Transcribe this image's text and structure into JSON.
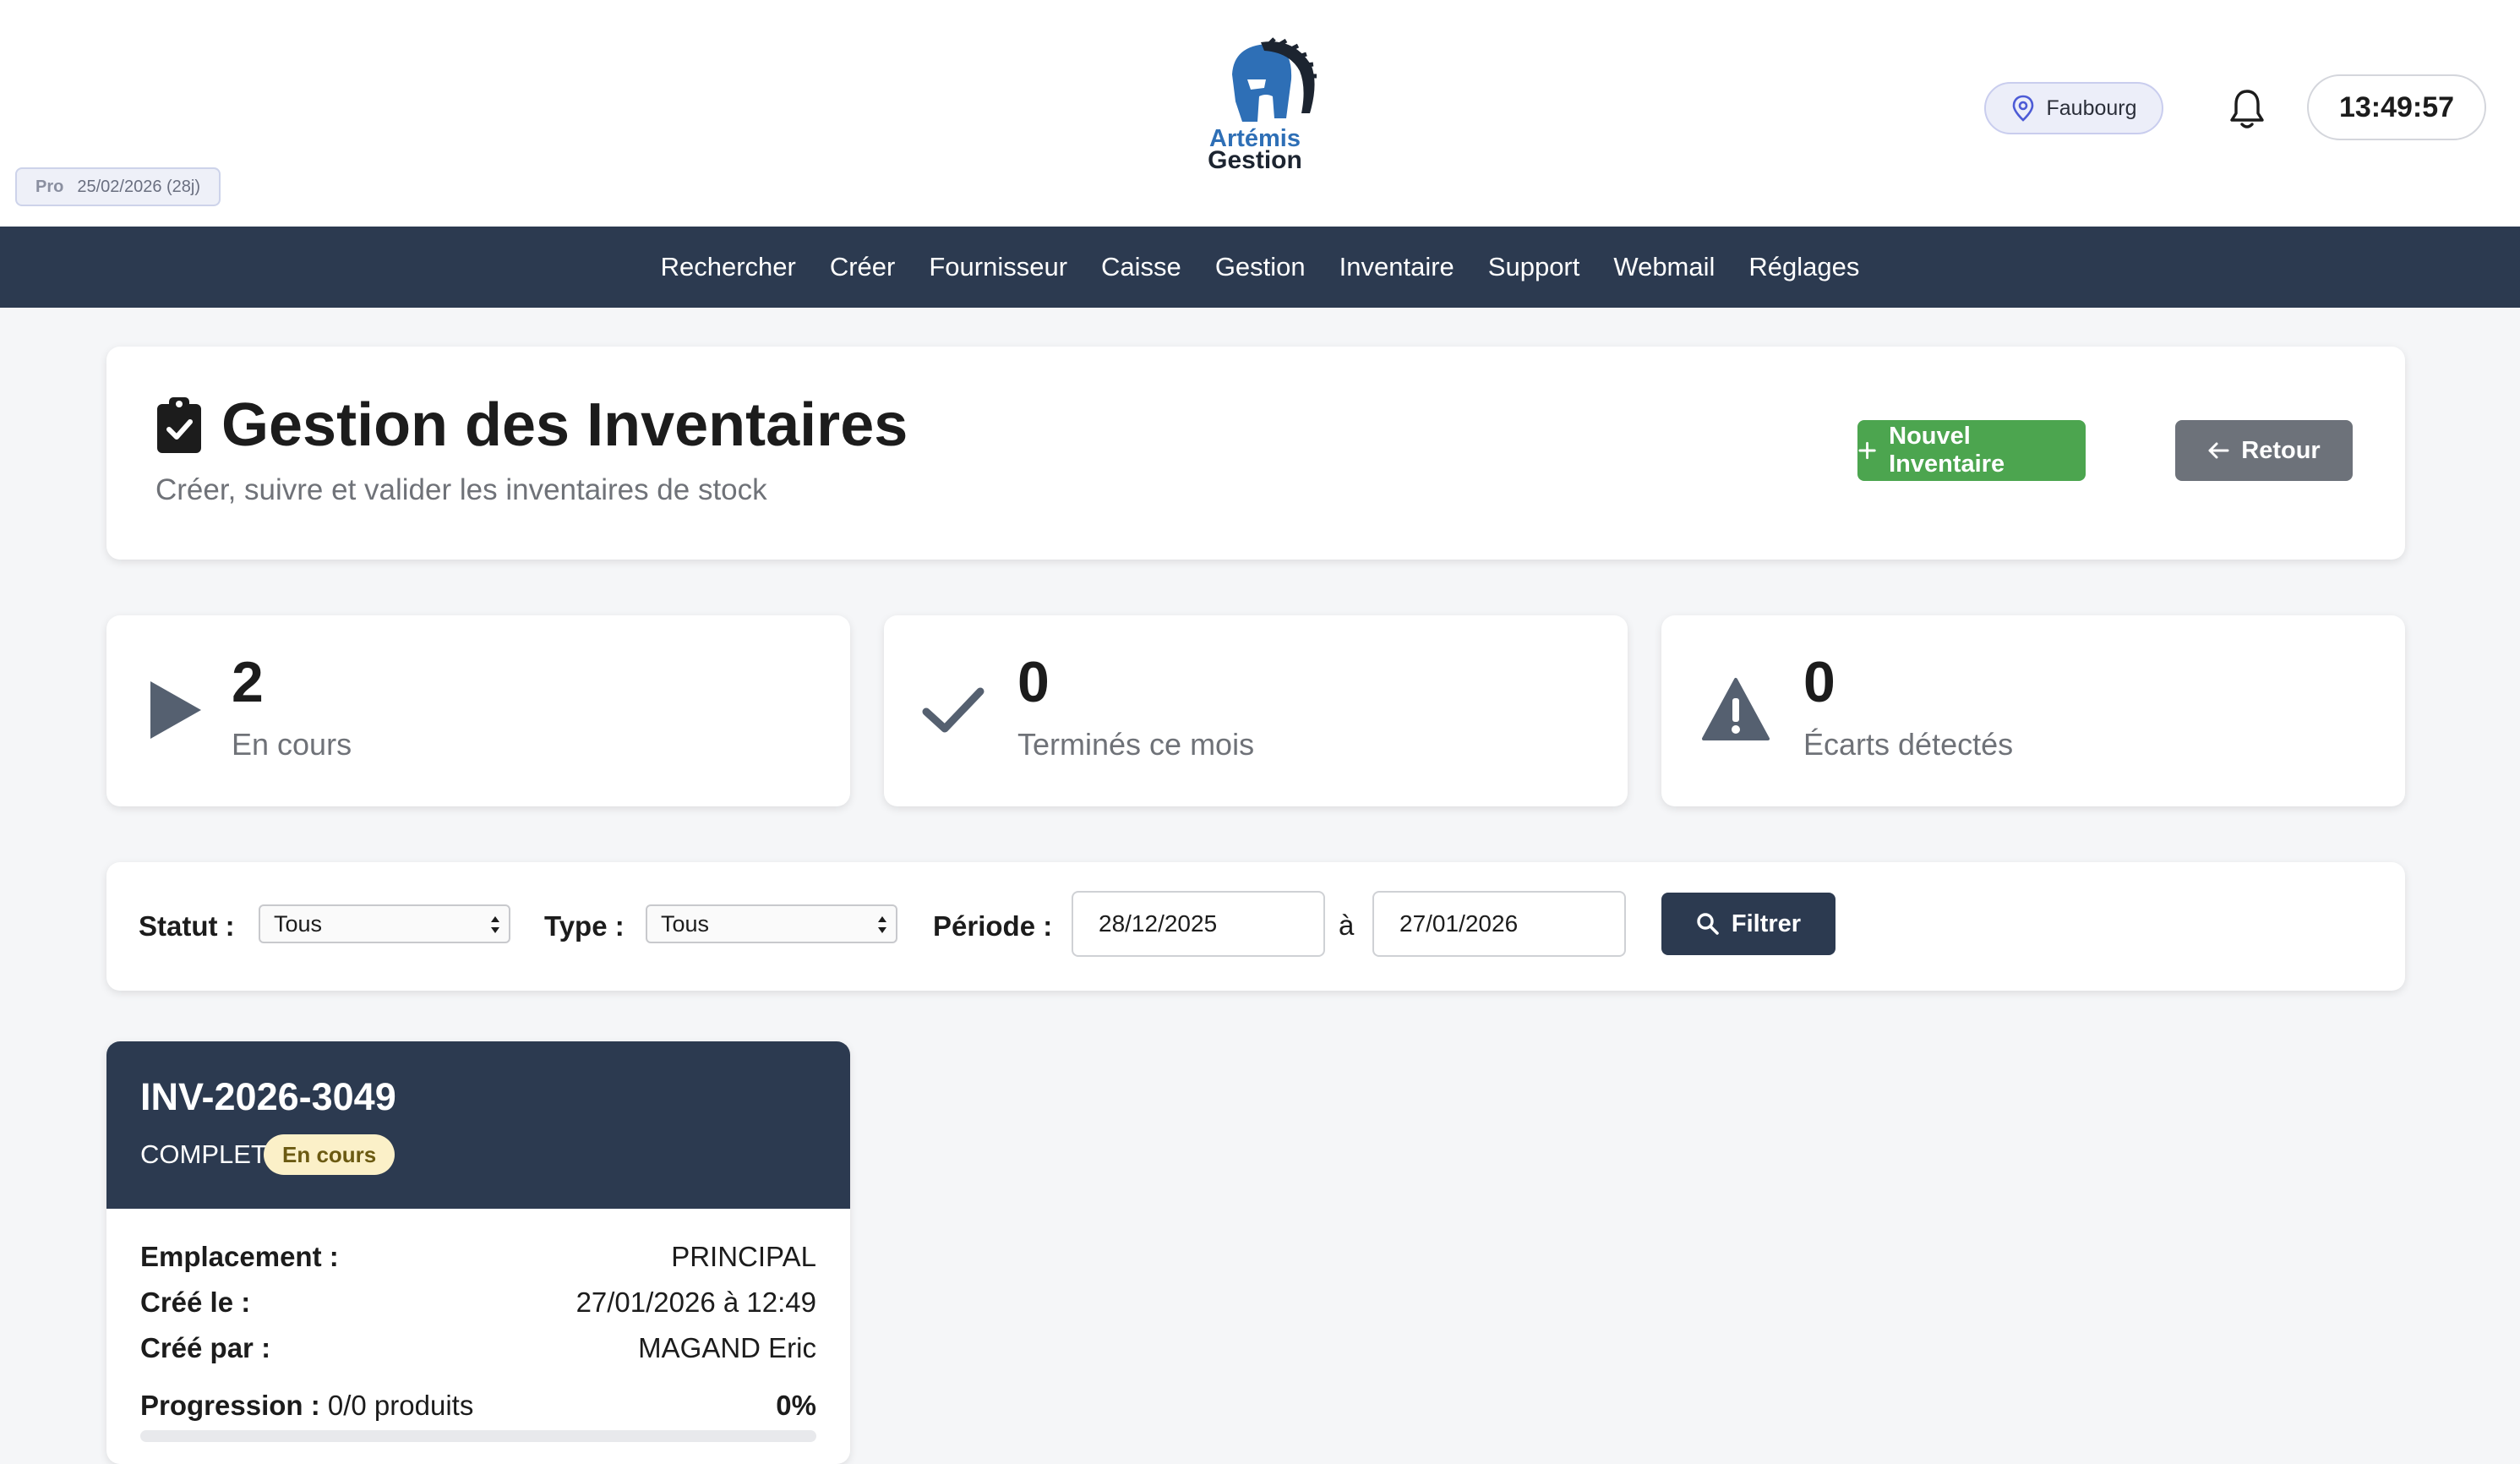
{
  "license": {
    "tier": "Pro",
    "expiry": "25/02/2026 (28j)"
  },
  "brand": {
    "line1": "Artémis",
    "line2": "Gestion"
  },
  "header": {
    "store": "Faubourg",
    "clock": "13:49:57"
  },
  "nav": {
    "items": [
      "Rechercher",
      "Créer",
      "Fournisseur",
      "Caisse",
      "Gestion",
      "Inventaire",
      "Support",
      "Webmail",
      "Réglages"
    ]
  },
  "page": {
    "title": "Gestion des Inventaires",
    "subtitle": "Créer, suivre et valider les inventaires de stock",
    "new_button": "Nouvel Inventaire",
    "back_button": "Retour"
  },
  "stats": [
    {
      "value": "2",
      "label": "En cours",
      "icon": "play-icon"
    },
    {
      "value": "0",
      "label": "Terminés ce mois",
      "icon": "check-icon"
    },
    {
      "value": "0",
      "label": "Écarts détectés",
      "icon": "warning-icon"
    }
  ],
  "filters": {
    "status_label": "Statut :",
    "status_value": "Tous",
    "type_label": "Type :",
    "type_value": "Tous",
    "period_label": "Période :",
    "date_from": "28/12/2025",
    "date_sep": "à",
    "date_to": "27/01/2026",
    "filter_button": "Filtrer"
  },
  "inventories": [
    {
      "id": "INV-2026-3049",
      "type": "COMPLET",
      "status": "En cours",
      "location_label": "Emplacement :",
      "location": "PRINCIPAL",
      "created_label": "Créé le :",
      "created": "27/01/2026 à 12:49",
      "created_by_label": "Créé par :",
      "created_by": "MAGAND Eric",
      "progress_label": "Progression :",
      "progress_text": "0/0 produits",
      "progress_pct": "0%",
      "progress_value": 0
    }
  ],
  "colors": {
    "navy": "#2c3a50",
    "green": "#4ca54f",
    "gray": "#6d727a",
    "badge": "#fbf0c8"
  }
}
